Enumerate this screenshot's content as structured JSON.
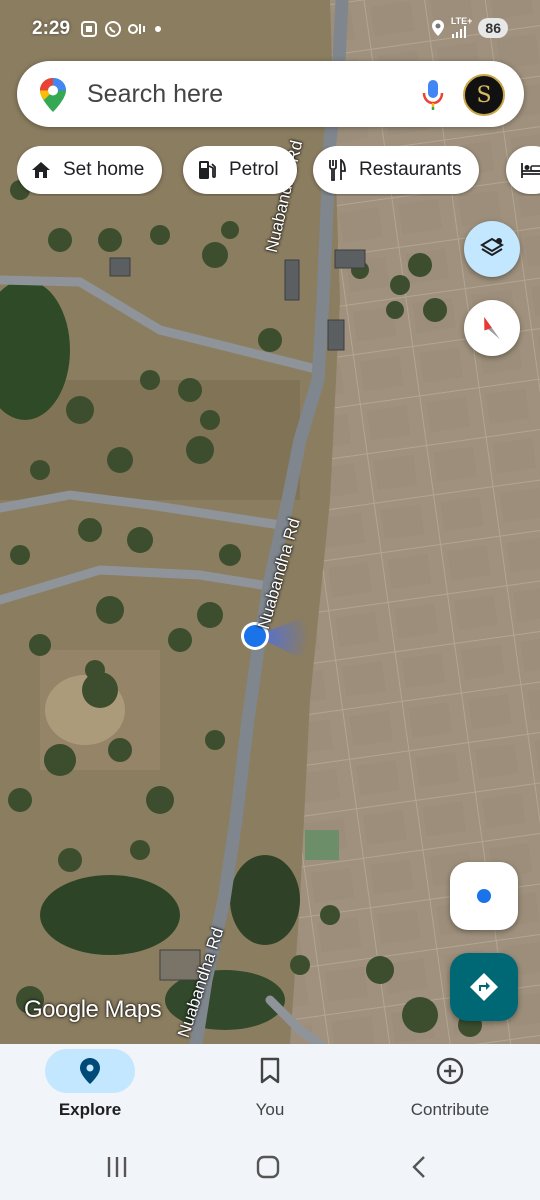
{
  "status_bar": {
    "time": "2:29",
    "network": "LTE+",
    "battery": "86",
    "icons": [
      "screenshot-icon",
      "whatsapp-icon",
      "vo-wifi-icon",
      "dot-icon",
      "location-icon",
      "signal-icon"
    ]
  },
  "search": {
    "placeholder": "Search here",
    "avatar_letter": "S"
  },
  "chips": [
    {
      "label": "Set home",
      "icon": "home-icon"
    },
    {
      "label": "Petrol",
      "icon": "fuel-icon"
    },
    {
      "label": "Restaurants",
      "icon": "restaurant-icon"
    },
    {
      "label": "",
      "icon": "hotel-icon"
    }
  ],
  "map": {
    "road_labels": [
      "Nuabandha Rd",
      "Nuabandha Rd",
      "Nuabandha Rd"
    ],
    "attribution": "Google Maps"
  },
  "bottom_nav": {
    "items": [
      {
        "label": "Explore",
        "icon": "explore-pin-icon",
        "active": true
      },
      {
        "label": "You",
        "icon": "bookmark-icon",
        "active": false
      },
      {
        "label": "Contribute",
        "icon": "add-circle-icon",
        "active": false
      }
    ]
  },
  "colors": {
    "accent_blue": "#1a73e8",
    "active_pill": "#c2e7ff",
    "directions": "#006874"
  }
}
